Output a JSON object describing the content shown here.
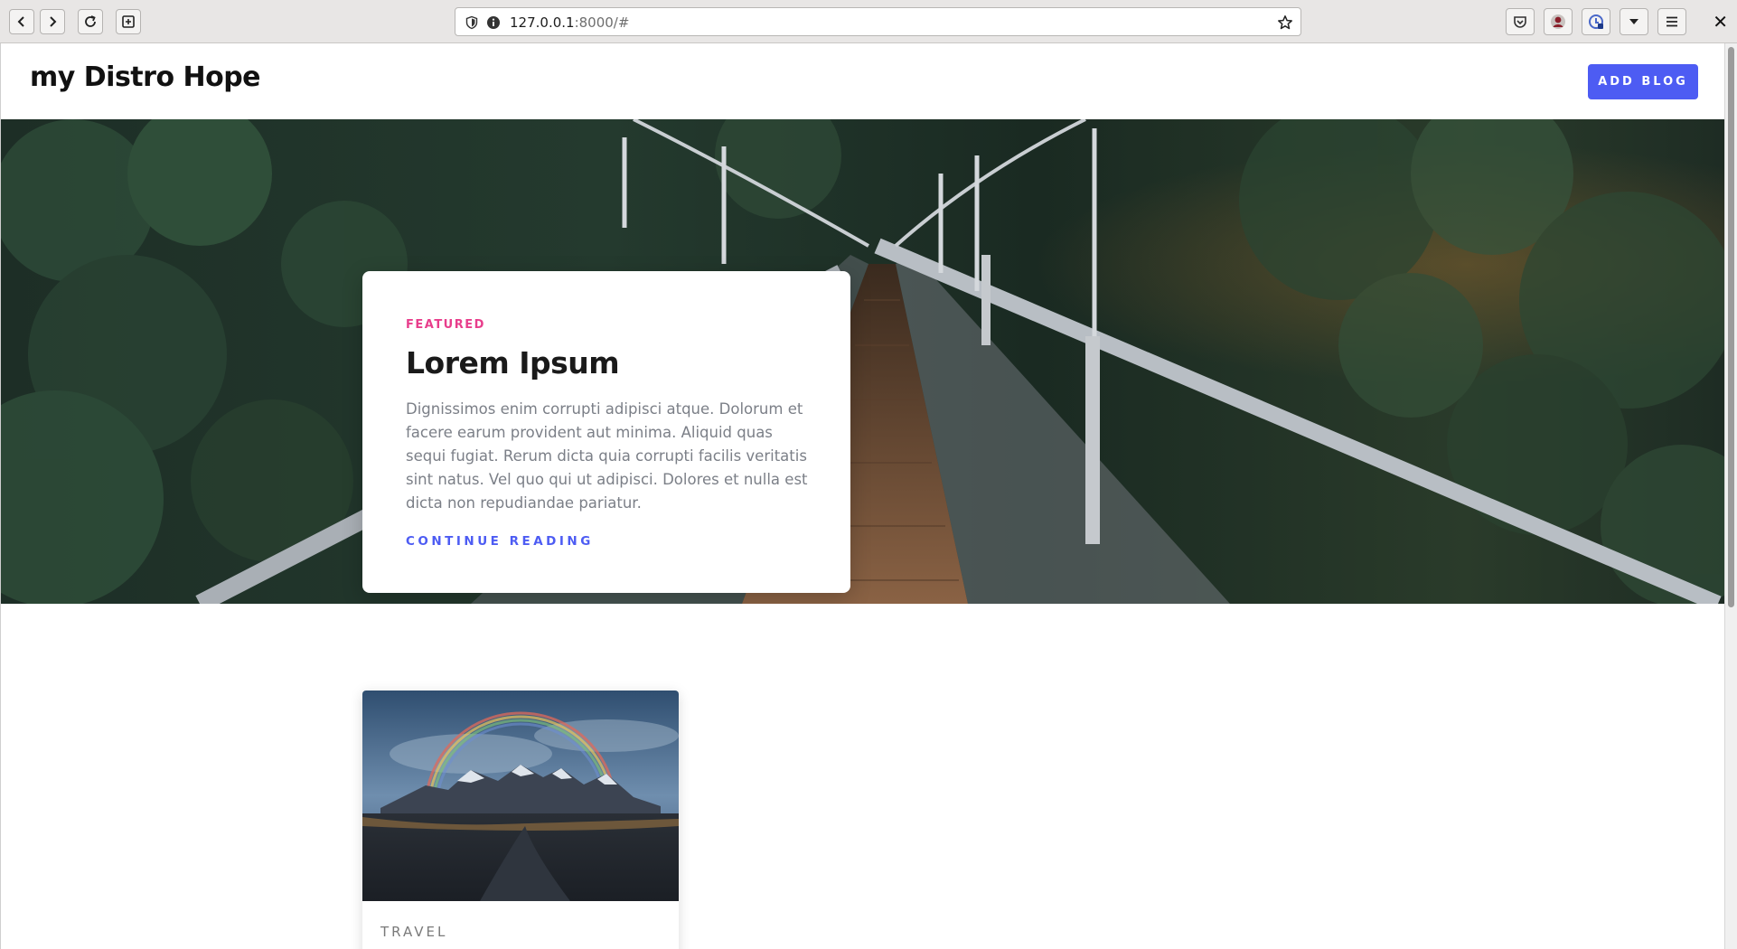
{
  "browser": {
    "url_host": "127.0.0.1",
    "url_rest": ":8000/#",
    "icons": [
      "back-icon",
      "forward-icon",
      "reload-icon",
      "new-tab-icon",
      "shield-icon",
      "info-icon",
      "star-icon",
      "pocket-icon",
      "profile-icon",
      "extension-icon",
      "dropdown-icon",
      "menu-icon",
      "close-icon"
    ],
    "close_label": "✕"
  },
  "header": {
    "brand": "my Distro Hope",
    "add_blog_label": "ADD BLOG"
  },
  "featured": {
    "label": "FEATURED",
    "title": "Lorem Ipsum",
    "body": "Dignissimos enim corrupti adipisci atque. Dolorum et facere earum provident aut minima. Aliquid quas sequi fugiat. Rerum dicta quia corrupti facilis veritatis sint natus. Vel quo qui ut adipisci. Dolores et nulla est dicta non repudiandae pariatur.",
    "link": "CONTINUE READING"
  },
  "posts": [
    {
      "category": "TRAVEL"
    }
  ],
  "colors": {
    "accent": "#4d5cf3",
    "featured_label": "#e83e8c",
    "body_text": "#7b7f87"
  }
}
